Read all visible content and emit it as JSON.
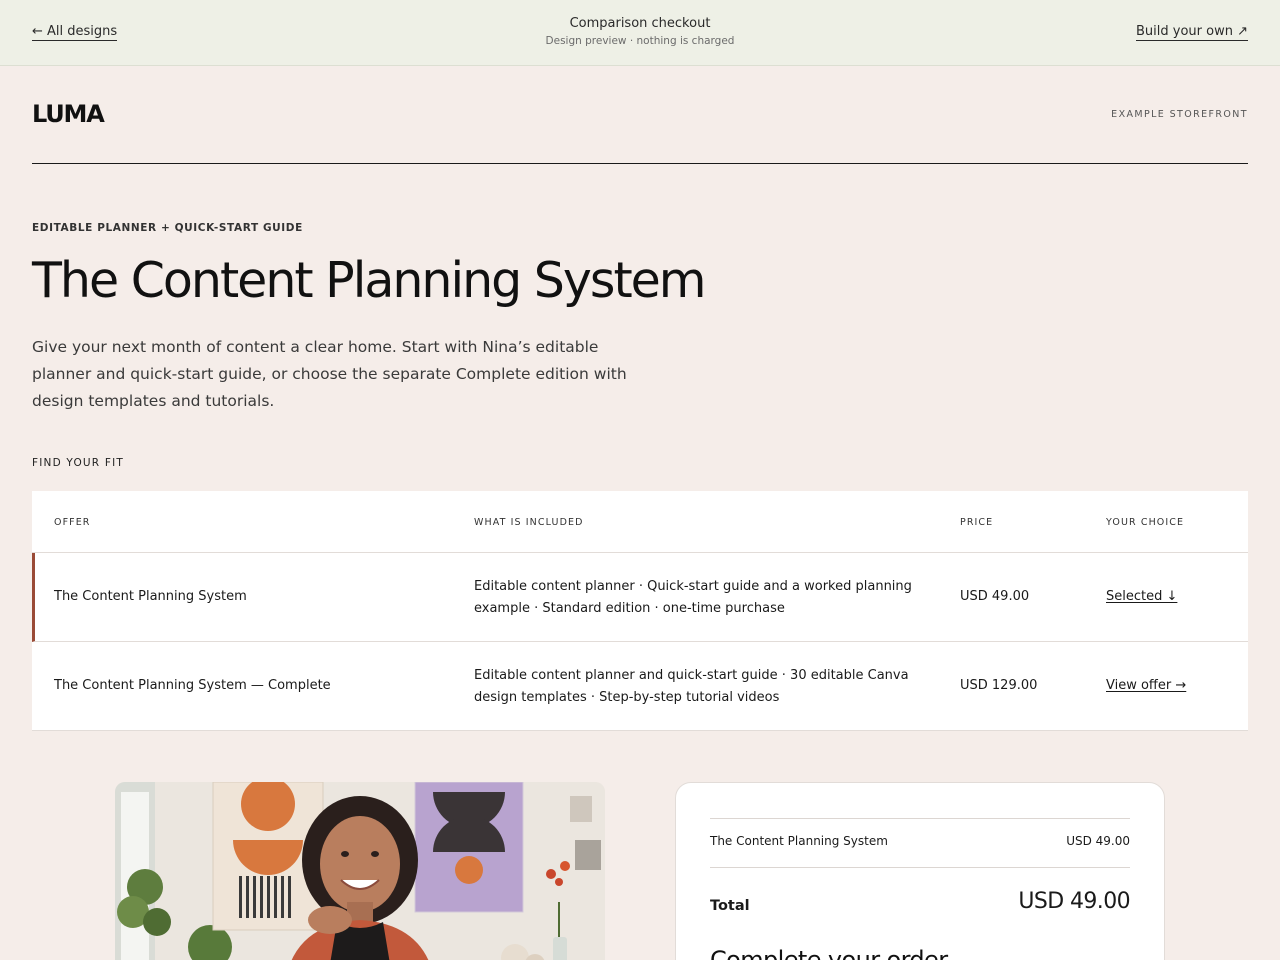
{
  "topbar": {
    "back_label": "← All designs",
    "center_title": "Comparison checkout",
    "center_subtitle": "Design preview · nothing is charged",
    "build_label": "Build your own ↗"
  },
  "brand": {
    "logo": "LUMA",
    "storefront_label": "EXAMPLE STOREFRONT"
  },
  "hero": {
    "eyebrow": "EDITABLE PLANNER + QUICK-START GUIDE",
    "title": "The Content Planning System",
    "lede": "Give your next month of content a clear home. Start with Nina’s editable planner and quick-start guide, or choose the separate Complete edition with design templates and tutorials."
  },
  "fit": {
    "label": "FIND YOUR FIT",
    "columns": [
      "OFFER",
      "WHAT IS INCLUDED",
      "PRICE",
      "YOUR CHOICE"
    ],
    "rows": [
      {
        "offer": "The Content Planning System",
        "included": "Editable content planner · Quick-start guide and a worked planning example · Standard edition · one-time purchase",
        "price": "USD 49.00",
        "choice": "Selected ↓"
      },
      {
        "offer": "The Content Planning System — Complete",
        "included": "Editable content planner and quick-start guide · 30 editable Canva design templates · Step-by-step tutorial videos",
        "price": "USD 129.00",
        "choice": "View offer →"
      }
    ]
  },
  "summary": {
    "item_name": "The Content Planning System",
    "item_price": "USD 49.00",
    "total_label": "Total",
    "total_value": "USD 49.00",
    "complete_heading": "Complete your order"
  },
  "colors": {
    "page_bg": "#f5ede9",
    "topbar_bg": "#eef0e6",
    "selected_accent": "#9a4a36"
  }
}
